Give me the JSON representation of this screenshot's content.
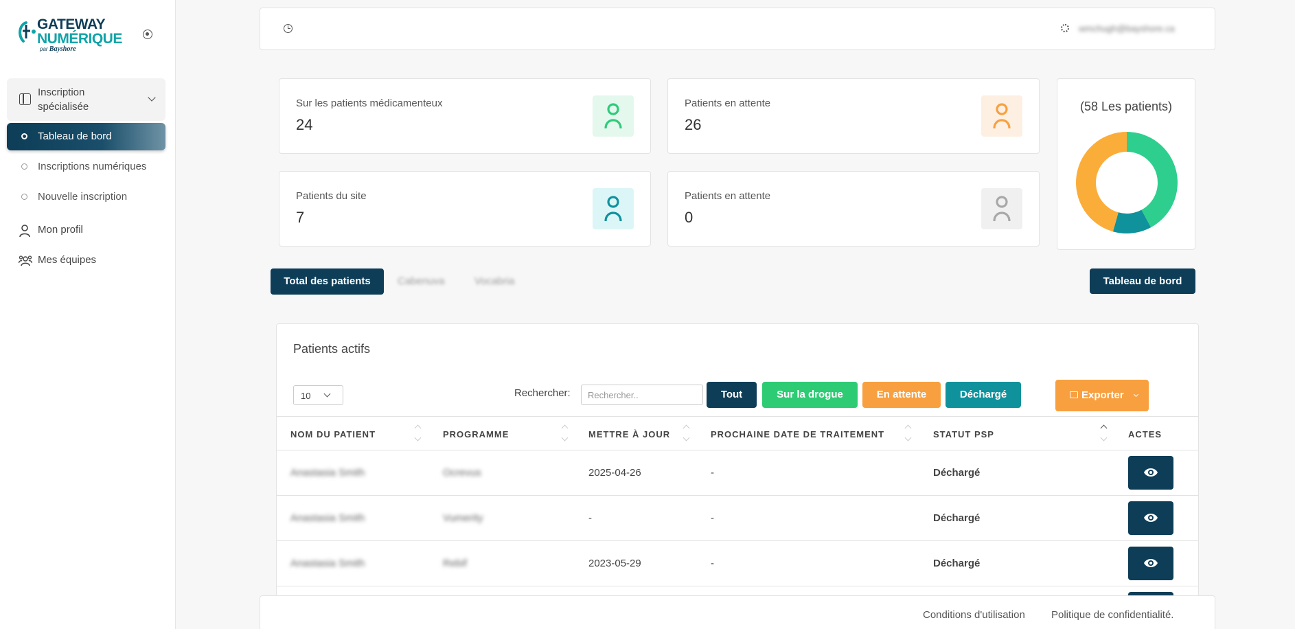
{
  "brand": {
    "line1": "GATEWAY",
    "line2": "NUMÉRIQUE",
    "line3_prefix": "par",
    "line3_brand": "Bayshore"
  },
  "sidebar": {
    "group_label": "Inscription spécialisée",
    "sub_items": [
      {
        "label": "Tableau de bord",
        "active": true
      },
      {
        "label": "Inscriptions numériques"
      },
      {
        "label": "Nouvelle inscription"
      }
    ],
    "nav_items": [
      {
        "label": "Mon profil",
        "icon": "user-icon"
      },
      {
        "label": "Mes équipes",
        "icon": "team-icon"
      }
    ]
  },
  "topbar": {
    "user_email": "wmchugh@bayshore.ca"
  },
  "stats": [
    {
      "title": "Sur les patients médicamenteux",
      "value": "24",
      "color": "#2ecb7b",
      "bg": "#e5f8ee"
    },
    {
      "title": "Patients en attente",
      "value": "26",
      "color": "#f8a040",
      "bg": "#fdf0e3"
    },
    {
      "title": "Patients du site",
      "value": "7",
      "color": "#10929c",
      "bg": "#dcf6f8"
    },
    {
      "title": "Patients en attente",
      "value": "0",
      "color": "#a8a8a8",
      "bg": "#f0f0f0"
    }
  ],
  "donut": {
    "title": "(58 Les patients)",
    "slices": [
      {
        "value": 24,
        "color": "#2ecf8e"
      },
      {
        "value": 7,
        "color": "#10929c"
      },
      {
        "value": 26,
        "color": "#fbad39"
      }
    ]
  },
  "tabs": {
    "active": "Total des patients",
    "others": [
      "Cabenuva",
      "Vocabria"
    ]
  },
  "dashboard_button": "Tableau de bord",
  "table": {
    "title": "Patients actifs",
    "page_size": "10",
    "search_label": "Rechercher:",
    "search_placeholder": "Rechercher..",
    "filters": [
      {
        "label": "Tout",
        "color": "#0d3d57"
      },
      {
        "label": "Sur la drogue",
        "color": "#2ecb75"
      },
      {
        "label": "En attente",
        "color": "#f8a040"
      },
      {
        "label": "Déchargé",
        "color": "#10929c"
      }
    ],
    "export_label": "Exporter",
    "columns": [
      "NOM DU PATIENT",
      "PROGRAMME",
      "METTRE À JOUR",
      "PROCHAINE DATE DE TRAITEMENT",
      "STATUT PSP",
      "ACTES"
    ],
    "rows": [
      {
        "name": "Anastasia Smith",
        "program": "Ocrevus",
        "updated": "2025-04-26",
        "next_date": "-",
        "status": "Déchargé"
      },
      {
        "name": "Anastasia Smith",
        "program": "Vumerity",
        "updated": "-",
        "next_date": "-",
        "status": "Déchargé"
      },
      {
        "name": "Anastasia Smith",
        "program": "Rebif",
        "updated": "2023-05-29",
        "next_date": "-",
        "status": "Déchargé"
      },
      {
        "name": "",
        "program": "",
        "updated": "",
        "next_date": "",
        "status": ""
      }
    ]
  },
  "footer": {
    "terms": "Conditions d'utilisation",
    "privacy": "Politique de confidentialité."
  }
}
